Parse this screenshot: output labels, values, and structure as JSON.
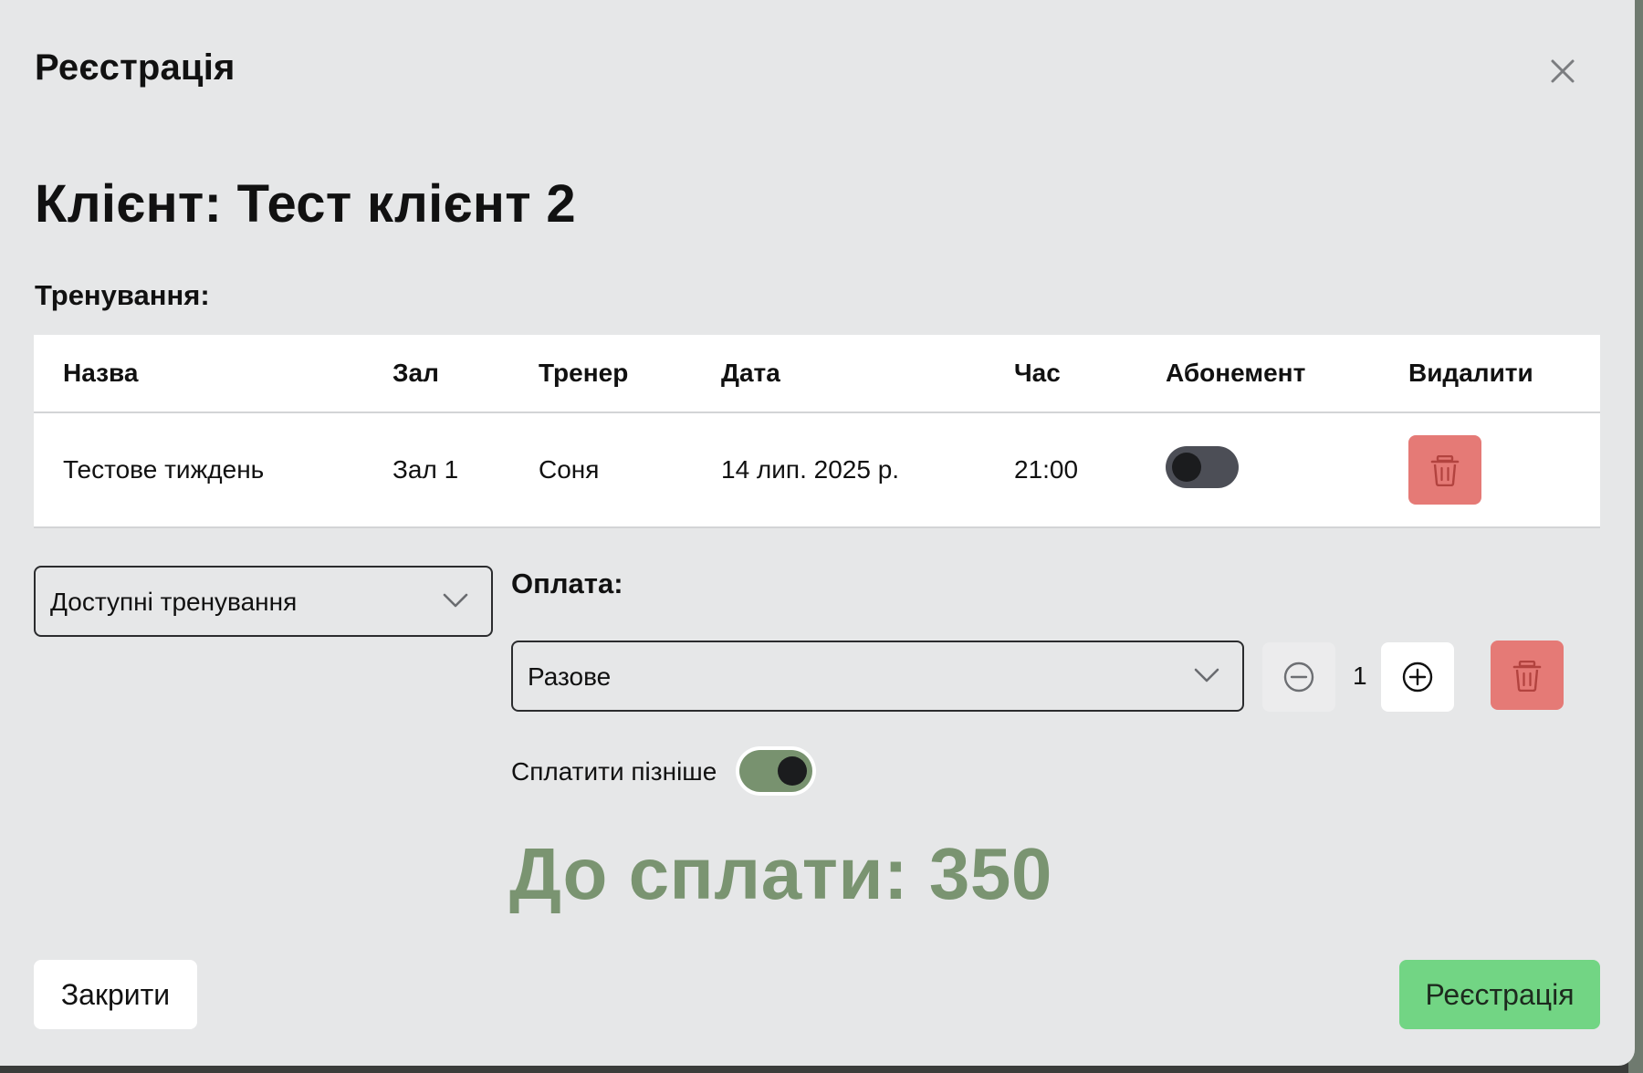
{
  "modal": {
    "title": "Реєстрація",
    "close_icon": "close-icon"
  },
  "client": {
    "heading": "Клієнт: Тест клієнт 2"
  },
  "workouts": {
    "label": "Тренування:",
    "columns": [
      "Назва",
      "Зал",
      "Тренер",
      "Дата",
      "Час",
      "Абонемент",
      "Видалити"
    ],
    "rows": [
      {
        "name": "Тестове тиждень",
        "hall": "Зал 1",
        "trainer": "Соня",
        "date": "14 лип. 2025 р.",
        "time": "21:00",
        "subscription_on": false,
        "delete_icon": "trash-icon"
      }
    ]
  },
  "available": {
    "value": "Доступні тренування",
    "icon": "chevron-down-icon"
  },
  "payment": {
    "label": "Оплата:",
    "type": "Разове",
    "quantity": "1",
    "minus_icon": "minus-circle-icon",
    "plus_icon": "plus-circle-icon",
    "delete_icon": "trash-icon",
    "pay_later_label": "Сплатити пізніше",
    "pay_later_on": true
  },
  "total": {
    "text": "До сплати: 350"
  },
  "footer": {
    "close_label": "Закрити",
    "register_label": "Реєстрація"
  },
  "colors": {
    "modal_bg": "#e6e7e8",
    "danger": "#e57a76",
    "primary": "#72d584",
    "total_text": "#7a9471",
    "toggle_on": "#78926f",
    "toggle_off": "#4c4e56"
  }
}
